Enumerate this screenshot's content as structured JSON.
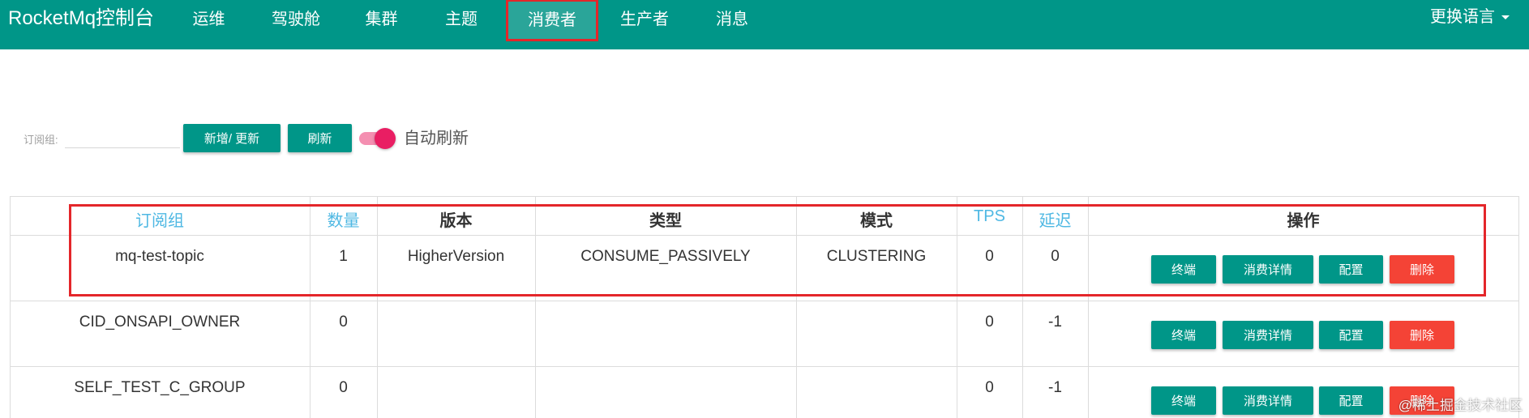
{
  "header": {
    "brand": "RocketMq控制台",
    "nav": [
      "运维",
      "驾驶舱",
      "集群",
      "主题",
      "消费者",
      "生产者",
      "消息"
    ],
    "active_nav": "消费者",
    "language_menu": "更换语言"
  },
  "toolbar": {
    "filter_label": "订阅组:",
    "filter_value": "",
    "add_update_label": "新增/ 更新",
    "refresh_label": "刷新",
    "auto_refresh_label": "自动刷新",
    "auto_refresh_on": true
  },
  "table": {
    "headers": {
      "group": "订阅组",
      "count": "数量",
      "version": "版本",
      "type": "类型",
      "mode": "模式",
      "tps": "TPS",
      "delay": "延迟",
      "ops": "操作"
    },
    "rows": [
      {
        "group": "mq-test-topic",
        "count": "1",
        "version": "HigherVersion",
        "type": "CONSUME_PASSIVELY",
        "mode": "CLUSTERING",
        "tps": "0",
        "delay": "0"
      },
      {
        "group": "CID_ONSAPI_OWNER",
        "count": "0",
        "version": "",
        "type": "",
        "mode": "",
        "tps": "0",
        "delay": "-1"
      },
      {
        "group": "SELF_TEST_C_GROUP",
        "count": "0",
        "version": "",
        "type": "",
        "mode": "",
        "tps": "0",
        "delay": "-1"
      }
    ],
    "actions": {
      "client": "终端",
      "detail": "消费详情",
      "config": "配置",
      "delete": "删除"
    }
  },
  "watermark": "@稀土掘金技术社区",
  "colors": {
    "primary": "#009688",
    "danger": "#f44336",
    "toggle": "#e91e63",
    "link_header": "#4fb8e3",
    "annotation": "#e4262a"
  }
}
